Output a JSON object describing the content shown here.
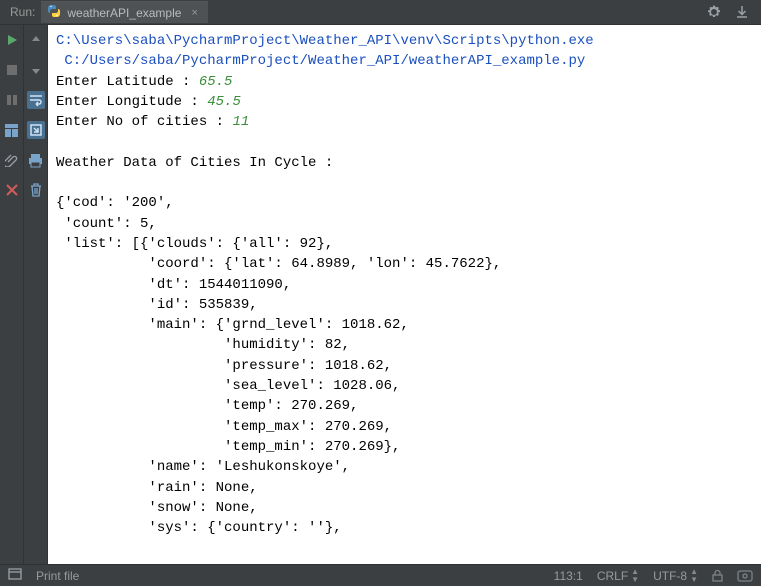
{
  "header": {
    "run_label": "Run:",
    "tab_name": "weatherAPI_example",
    "tab_close": "×"
  },
  "console": {
    "exe_path": "C:\\Users\\saba\\PycharmProject\\Weather_API\\venv\\Scripts\\python.exe",
    "script_path": " C:/Users/saba/PycharmProject/Weather_API/weatherAPI_example.py",
    "prompt_lat": "Enter Latitude : ",
    "val_lat": "65.5",
    "prompt_lon": "Enter Longitude : ",
    "val_lon": "45.5",
    "prompt_cities": "Enter No of cities : ",
    "val_cities": "11",
    "header_line": "Weather Data of Cities In Cycle :",
    "lines": [
      "{'cod': '200',",
      " 'count': 5,",
      " 'list': [{'clouds': {'all': 92},",
      "           'coord': {'lat': 64.8989, 'lon': 45.7622},",
      "           'dt': 1544011090,",
      "           'id': 535839,",
      "           'main': {'grnd_level': 1018.62,",
      "                    'humidity': 82,",
      "                    'pressure': 1018.62,",
      "                    'sea_level': 1028.06,",
      "                    'temp': 270.269,",
      "                    'temp_max': 270.269,",
      "                    'temp_min': 270.269},",
      "           'name': 'Leshukonskoye',",
      "           'rain': None,",
      "           'snow': None,",
      "           'sys': {'country': ''},"
    ]
  },
  "status": {
    "hint": "Print file",
    "pos": "113:1",
    "line_sep": "CRLF",
    "encoding": "UTF-8"
  },
  "chart_data": {
    "type": "table",
    "title": "Weather Data of Cities In Cycle",
    "inputs": {
      "latitude": 65.5,
      "longitude": 45.5,
      "no_of_cities": 11
    },
    "cod": "200",
    "count": 5,
    "list": [
      {
        "clouds": {
          "all": 92
        },
        "coord": {
          "lat": 64.8989,
          "lon": 45.7622
        },
        "dt": 1544011090,
        "id": 535839,
        "main": {
          "grnd_level": 1018.62,
          "humidity": 82,
          "pressure": 1018.62,
          "sea_level": 1028.06,
          "temp": 270.269,
          "temp_max": 270.269,
          "temp_min": 270.269
        },
        "name": "Leshukonskoye",
        "rain": null,
        "snow": null,
        "sys": {
          "country": ""
        }
      }
    ]
  }
}
